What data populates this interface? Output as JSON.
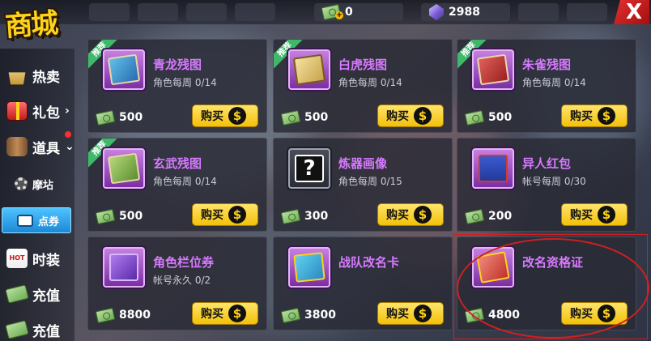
{
  "shop_title": "商城",
  "currencies": {
    "cash": {
      "value": "0",
      "icon": "cash-icon"
    },
    "gems": {
      "value": "2988",
      "icon": "gem-icon"
    }
  },
  "close_label": "X",
  "sidebar": [
    {
      "label": "热卖",
      "icon": "basket-icon"
    },
    {
      "label": "礼包",
      "icon": "gift-icon",
      "arrow": "›"
    },
    {
      "label": "道具",
      "icon": "barrel-icon",
      "arrow": "⌄"
    },
    {
      "label": "摩坫",
      "icon": "gear-icon"
    },
    {
      "label": "点券",
      "icon": "ticket-icon"
    },
    {
      "label": "时装",
      "icon": "hot-icon",
      "icon_text": "HOT"
    },
    {
      "label": "充值",
      "icon": "cash-icon"
    },
    {
      "label": "充值",
      "icon": "cash-icon"
    }
  ],
  "buy_label": "购买",
  "coin_symbol": "$",
  "recommend_tag": "推荐",
  "items": [
    {
      "name": "青龙残图",
      "sub": "角色每周 0/14",
      "price": "500",
      "tag": "推荐",
      "art": "blue-scroll"
    },
    {
      "name": "白虎残图",
      "sub": "角色每周 0/14",
      "price": "500",
      "tag": "推荐",
      "art": "gold-scroll"
    },
    {
      "name": "朱雀残图",
      "sub": "角色每周 0/14",
      "price": "500",
      "tag": "推荐",
      "art": "red-scroll"
    },
    {
      "name": "玄武残图",
      "sub": "角色每周 0/14",
      "price": "500",
      "tag": "推荐",
      "art": "green-scroll"
    },
    {
      "name": "炼器画像",
      "sub": "角色每周 0/15",
      "price": "300",
      "tag": "",
      "art": "unknown"
    },
    {
      "name": "异人红包",
      "sub": "帐号每周 0/30",
      "price": "200",
      "tag": "",
      "art": "envelope"
    },
    {
      "name": "角色栏位券",
      "sub": "帐号永久 0/2",
      "price": "8800",
      "tag": "",
      "art": "book"
    },
    {
      "name": "战队改名卡",
      "sub": "",
      "price": "3800",
      "tag": "",
      "art": "blue-card"
    },
    {
      "name": "改名资格证",
      "sub": "",
      "price": "4800",
      "tag": "",
      "art": "red-card"
    }
  ]
}
